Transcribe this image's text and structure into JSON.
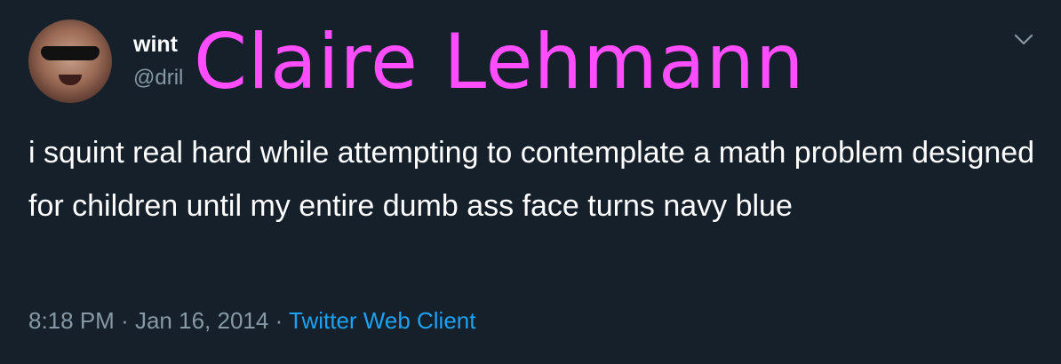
{
  "tweet": {
    "display_name": "wint",
    "handle": "@dril",
    "overlay_text": "Claire Lehmann",
    "text": "i squint real hard while attempting to contemplate a math problem designed for children until my entire dumb ass face turns navy blue",
    "time": "8:18 PM",
    "separator": "·",
    "date": "Jan 16, 2014",
    "source": "Twitter Web Client",
    "menu_icon": "chevron-down-icon"
  },
  "colors": {
    "background": "#15202b",
    "primary_text": "#ffffff",
    "secondary_text": "#8899a6",
    "link": "#1da1f2",
    "overlay": "#ff4dff"
  }
}
